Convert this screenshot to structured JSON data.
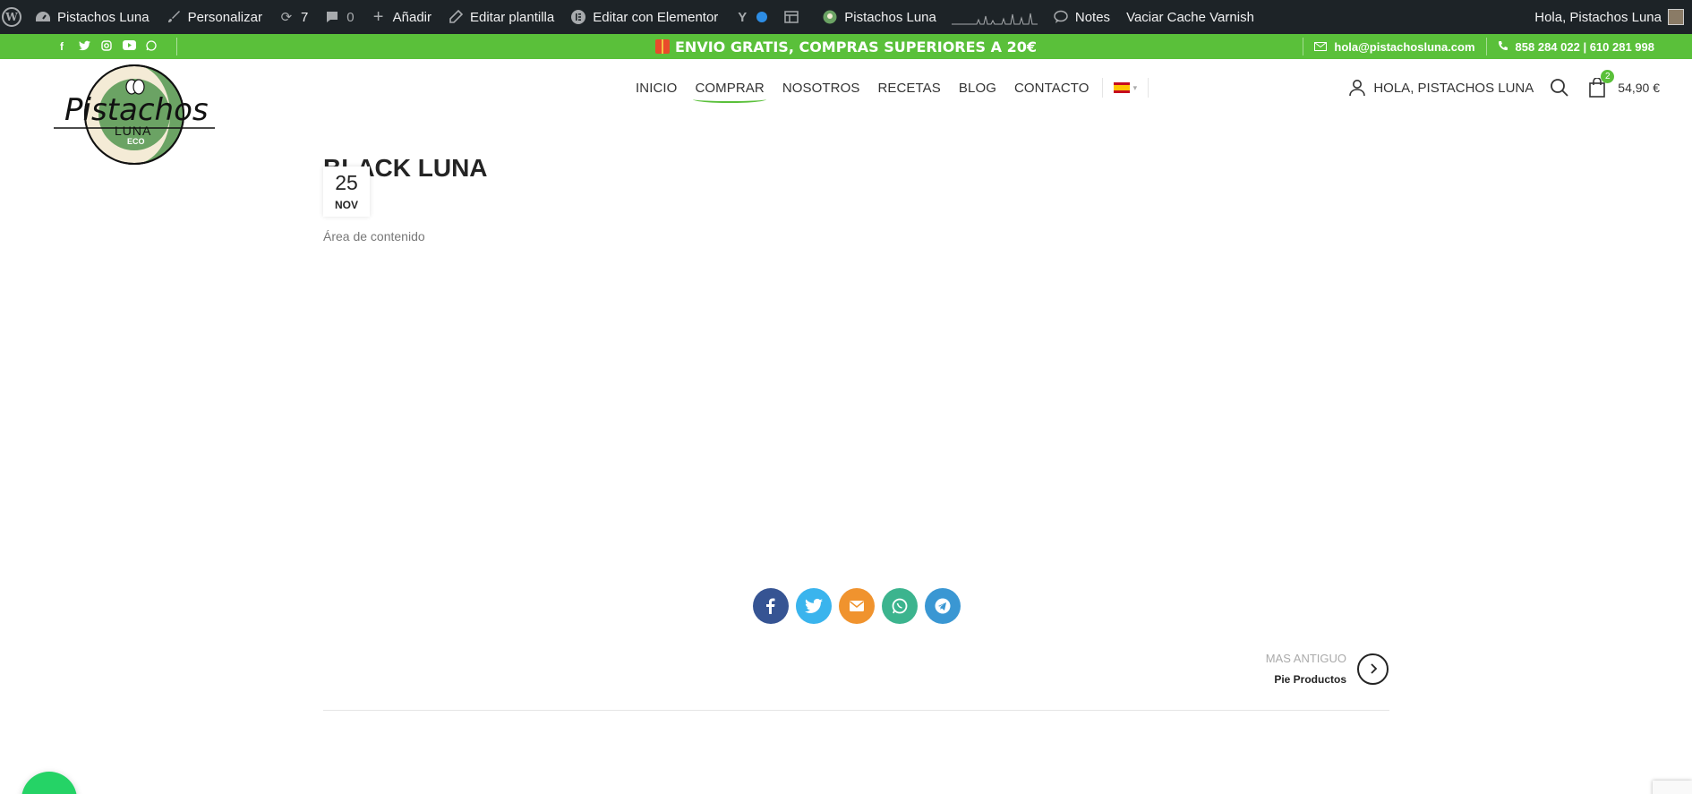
{
  "admin_bar": {
    "site_name": "Pistachos Luna",
    "customize": "Personalizar",
    "updates_count": "7",
    "comments_count": "0",
    "add_new": "Añadir",
    "edit_template": "Editar plantilla",
    "edit_elementor": "Editar con Elementor",
    "site_name_2": "Pistachos Luna",
    "notes": "Notes",
    "varnish": "Vaciar Cache Varnish",
    "greeting": "Hola, Pistachos Luna"
  },
  "promo": {
    "text": "ENVIO GRATIS, COMPRAS SUPERIORES A 20€",
    "email": "hola@pistachosluna.com",
    "phone": "858 284 022 | 610 281 998",
    "social_icons": [
      "facebook-icon",
      "twitter-icon",
      "instagram-icon",
      "youtube-icon",
      "whatsapp-icon"
    ]
  },
  "logo": {
    "name": "Pistachos",
    "sub": "LUNA",
    "tag": "ECO"
  },
  "nav": {
    "items": [
      "INICIO",
      "COMPRAR",
      "NOSOTROS",
      "RECETAS",
      "BLOG",
      "CONTACTO"
    ],
    "active": "COMPRAR"
  },
  "header": {
    "account": "HOLA, PISTACHOS LUNA",
    "cart_count": "2",
    "cart_total": "54,90 €"
  },
  "post": {
    "title": "BLACK LUNA",
    "day": "25",
    "month": "NOV",
    "content": "Área de contenido"
  },
  "share_colors": {
    "facebook": "#365493",
    "twitter": "#3ab4ed",
    "email": "#f0932e",
    "whatsapp": "#3cb48e",
    "telegram": "#3a97d3"
  },
  "older_post": {
    "label": "MAS ANTIGUO",
    "title": "Pie Productos"
  },
  "colors": {
    "brand_green": "#5ac03a",
    "admin_bar": "#1d2327"
  }
}
